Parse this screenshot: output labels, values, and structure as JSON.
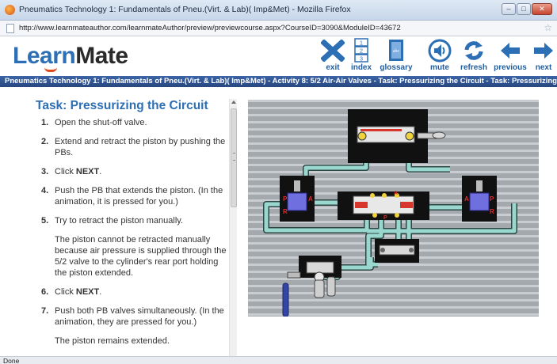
{
  "window": {
    "title": "Pneumatics Technology 1: Fundamentals of Pneu.(Virt. & Lab)( Imp&Met) - Mozilla Firefox",
    "url": "http://www.learnmateauthor.com/learnmateAuthor/preview/previewcourse.aspx?CourseID=3090&ModuleID=43672"
  },
  "logo": {
    "part1": "Learn",
    "part2": "Mate"
  },
  "toolbar": [
    {
      "label": "exit",
      "icon": "close-x-icon"
    },
    {
      "label": "index",
      "icon": "numbered-list-icon"
    },
    {
      "label": "glossary",
      "icon": "book-icon"
    },
    {
      "label": "mute",
      "icon": "speaker-mute-icon"
    },
    {
      "label": "refresh",
      "icon": "refresh-icon"
    },
    {
      "label": "previous",
      "icon": "arrow-left-icon"
    },
    {
      "label": "next",
      "icon": "arrow-right-icon"
    }
  ],
  "breadcrumb": "Pneumatics Technology 1: Fundamentals of Pneu.(Virt. & Lab)( Imp&Met)  -  Activity 8: 5/2 Air-Air Valves  -  Task: Pressurizing the Circuit  -  Task: Pressurizing the",
  "task": {
    "title": "Task: Pressurizing the Circuit",
    "steps": [
      {
        "num": "1.",
        "text": "Open the shut-off valve."
      },
      {
        "num": "2.",
        "text": "Extend and retract the piston by pushing the PBs."
      },
      {
        "num": "3.",
        "pre": "Click ",
        "bold": "NEXT",
        "post": "."
      },
      {
        "num": "4.",
        "text": "Push the PB that extends the piston. (In the animation, it is pressed for you.)"
      },
      {
        "num": "5.",
        "text": "Try to retract the piston manually.",
        "para": "The piston cannot be retracted manually because air pressure is supplied through the 5/2 valve to the cylinder's rear port holding the piston extended."
      },
      {
        "num": "6.",
        "pre": "Click ",
        "bold": "NEXT",
        "post": "."
      },
      {
        "num": "7.",
        "text": "Push both PB valves simultaneously. (In the animation, they are pressed for you.)",
        "para": "The piston remains extended."
      }
    ]
  },
  "diagram": {
    "port_labels": {
      "pressure": "P",
      "return": "R",
      "actuator": "A"
    }
  },
  "status": "Done",
  "colors": {
    "brand_blue": "#2c6fb5",
    "breadcrumb_bg": "#2f5392",
    "tube": "#9ad8cf",
    "panel_bg": "#9aa0a6"
  }
}
